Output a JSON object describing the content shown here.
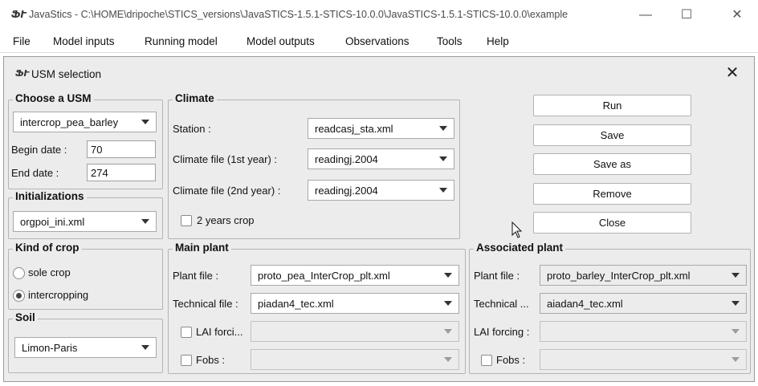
{
  "window": {
    "icon": "javastics-icon",
    "title": "JavaStics - C:\\HOME\\dripoche\\STICS_versions\\JavaSTICS-1.5.1-STICS-10.0.0\\JavaSTICS-1.5.1-STICS-10.0.0\\example",
    "minimize": "—",
    "maximize": "☐",
    "close": "✕"
  },
  "menu": [
    "File",
    "Model inputs",
    "Running model",
    "Model outputs",
    "Observations",
    "Tools",
    "Help"
  ],
  "dialog": {
    "icon": "javastics-icon",
    "title": "USM selection",
    "close": "✕"
  },
  "choose_usm": {
    "legend": "Choose a USM",
    "usm": "intercrop_pea_barley",
    "begin_label": "Begin date :",
    "begin_value": "70",
    "end_label": "End date :",
    "end_value": "274"
  },
  "initializations": {
    "legend": "Initializations",
    "file": "orgpoi_ini.xml"
  },
  "climate": {
    "legend": "Climate",
    "station_label": "Station :",
    "station_value": "readcasj_sta.xml",
    "file1_label": "Climate file (1st year) :",
    "file1_value": "readingj.2004",
    "file2_label": "Climate file (2nd year) :",
    "file2_value": "readingj.2004",
    "two_years_label": "2 years crop",
    "two_years_checked": false
  },
  "buttons": [
    "Run",
    "Save",
    "Save as",
    "Remove",
    "Close"
  ],
  "kind_of_crop": {
    "legend": "Kind of crop",
    "options": [
      "sole crop",
      "intercropping"
    ],
    "selected": "intercropping"
  },
  "soil": {
    "legend": "Soil",
    "value": "Limon-Paris"
  },
  "main_plant": {
    "legend": "Main plant",
    "plant_label": "Plant file :",
    "plant_value": "proto_pea_InterCrop_plt.xml",
    "tech_label": "Technical file :",
    "tech_value": "piadan4_tec.xml",
    "lai_label": "LAI forci...",
    "fobs_label": "Fobs :"
  },
  "associated_plant": {
    "legend": "Associated plant",
    "plant_label": "Plant file :",
    "plant_value": "proto_barley_InterCrop_plt.xml",
    "tech_label": "Technical ...",
    "tech_value": "aiadan4_tec.xml",
    "lai_label": "LAI forcing :",
    "fobs_label": "Fobs :"
  }
}
